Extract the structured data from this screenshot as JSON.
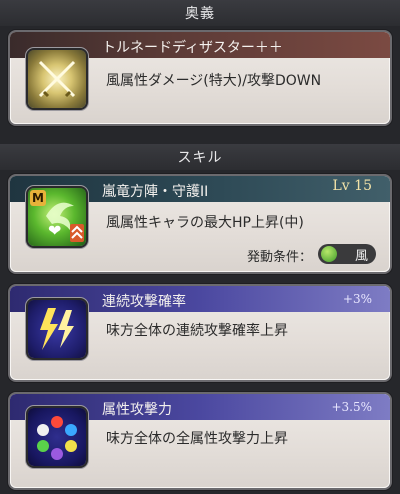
{
  "ougi": {
    "header": "奥義",
    "name": "トルネードディザスター＋＋",
    "description": "風属性ダメージ(特大)/攻撃DOWN"
  },
  "skills": {
    "header": "スキル",
    "items": [
      {
        "name": "嵐竜方陣・守護II",
        "level_label": "Lv",
        "level": "15",
        "description": "風属性キャラの最大HP上昇(中)",
        "condition_label": "発動条件：",
        "condition_value": "風",
        "icon": "wind-dragon-guard-icon"
      },
      {
        "name": "連続攻撃確率",
        "value": "+3%",
        "description": "味方全体の連続攻撃確率上昇",
        "icon": "lightning-bolts-icon"
      },
      {
        "name": "属性攻撃力",
        "value": "+3.5%",
        "description": "味方全体の全属性攻撃力上昇",
        "icon": "element-orbs-icon"
      }
    ]
  },
  "colors": {
    "background": "#26272b",
    "level_text": "#f0d27a",
    "wind_green": "#3e9a2a"
  }
}
